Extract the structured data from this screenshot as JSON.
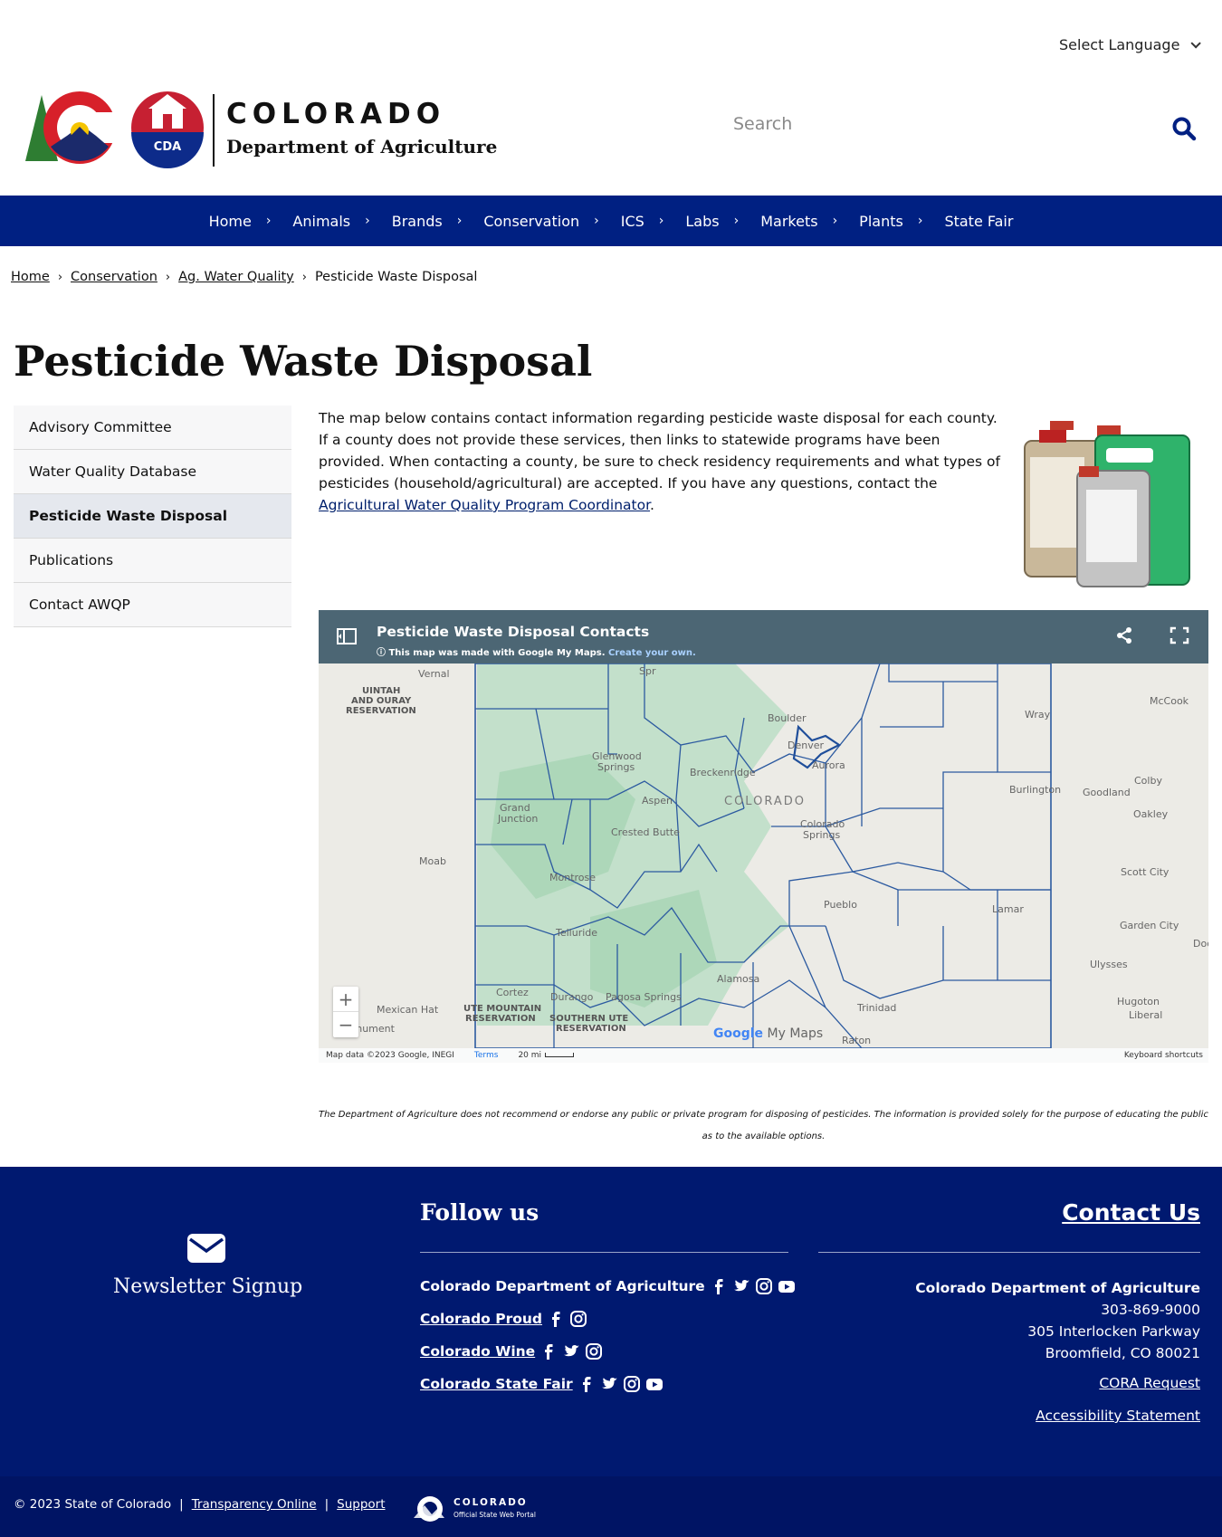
{
  "language": {
    "label": "Select Language"
  },
  "brand": {
    "state": "COLORADO",
    "department": "Department of Agriculture",
    "badge": "CDA"
  },
  "search": {
    "placeholder": "Search"
  },
  "nav": {
    "items": [
      {
        "label": "Home"
      },
      {
        "label": "Animals"
      },
      {
        "label": "Brands"
      },
      {
        "label": "Conservation"
      },
      {
        "label": "ICS"
      },
      {
        "label": "Labs"
      },
      {
        "label": "Markets"
      },
      {
        "label": "Plants"
      },
      {
        "label": "State Fair"
      }
    ]
  },
  "breadcrumb": {
    "items": [
      {
        "label": "Home"
      },
      {
        "label": "Conservation"
      },
      {
        "label": "Ag. Water Quality"
      }
    ],
    "current": "Pesticide Waste Disposal"
  },
  "page": {
    "title": "Pesticide Waste Disposal"
  },
  "sidebar": {
    "items": [
      {
        "label": "Advisory Committee",
        "active": false
      },
      {
        "label": "Water Quality Database",
        "active": false
      },
      {
        "label": "Pesticide Waste Disposal",
        "active": true
      },
      {
        "label": "Publications",
        "active": false
      },
      {
        "label": "Contact AWQP",
        "active": false
      }
    ]
  },
  "intro": {
    "text": "The map below contains contact information regarding pesticide waste disposal for each county. If a county does not provide these services, then links to statewide programs have been provided. When contacting a county, be sure to check residency requirements and what types of pesticides (household/agricultural) are accepted. If you have any questions, contact the ",
    "link": "Agricultural Water Quality Program Coordinator",
    "end": "."
  },
  "map": {
    "title": "Pesticide Waste Disposal Contacts",
    "made_with": "This map was made with Google My Maps.",
    "create_own": "Create your own.",
    "attribution": "Map data ©2023 Google, INEGI",
    "terms": "Terms",
    "scale": "20 mi",
    "keyboard": "Keyboard shortcuts",
    "brand_google": "Google",
    "brand_mymaps": "My Maps",
    "state_label": "COLORADO",
    "places": [
      "Vernal",
      "UINTAH",
      "AND OURAY",
      "RESERVATION",
      "Boulder",
      "Denver",
      "Aurora",
      "Glenwood",
      "Springs",
      "Breckenridge",
      "Aspen",
      "Grand",
      "Junction",
      "Crested Butte",
      "Colorado",
      "Springs",
      "Montrose",
      "Moab",
      "Pueblo",
      "Telluride",
      "Cortez",
      "Durango",
      "Pagosa Springs",
      "Alamosa",
      "Trinidad",
      "Mexican Hat",
      "Monument",
      "UTE MOUNTAIN",
      "RESERVATION",
      "SOUTHERN UTE",
      "RESERVATION",
      "Raton",
      "Wray",
      "McCook",
      "Burlington",
      "Goodland",
      "Colby",
      "Oakley",
      "Scott City",
      "Lamar",
      "Garden City",
      "Ulysses",
      "Hugoton",
      "Liberal",
      "Dod",
      "Spr"
    ]
  },
  "disclaimer": "The Department of Agriculture does not recommend or endorse any public or private program for disposing of pesticides. The information is provided solely for the purpose of educating the public as to the available options.",
  "footer": {
    "newsletter": "Newsletter Signup",
    "follow_title": "Follow us",
    "follow": [
      {
        "name": "Colorado Department of Agriculture",
        "icons": [
          "facebook-icon",
          "twitter-icon",
          "instagram-icon",
          "youtube-icon"
        ]
      },
      {
        "name": "Colorado Proud",
        "icons": [
          "facebook-icon",
          "instagram-icon"
        ]
      },
      {
        "name": "Colorado Wine",
        "icons": [
          "facebook-icon",
          "twitter-icon",
          "instagram-icon"
        ]
      },
      {
        "name": "Colorado State Fair",
        "icons": [
          "facebook-icon",
          "twitter-icon",
          "instagram-icon",
          "youtube-icon"
        ]
      }
    ],
    "contact_title": "Contact Us",
    "contact": {
      "org": "Colorado Department of Agriculture",
      "phone": "303-869-9000",
      "address1": "305 Interlocken Parkway",
      "address2": "Broomfield, CO 80021",
      "cora": "CORA Request",
      "accessibility": "Accessibility Statement"
    }
  },
  "bottom": {
    "copyright": "© 2023 State of Colorado",
    "transparency": "Transparency Online",
    "support": "Support",
    "portal_title": "COLORADO",
    "portal_sub": "Official State Web Portal"
  },
  "colors": {
    "nav": "#002082",
    "footer": "#001970",
    "bottom": "#001464",
    "map_bar": "#4c6674",
    "link": "#00206c"
  }
}
